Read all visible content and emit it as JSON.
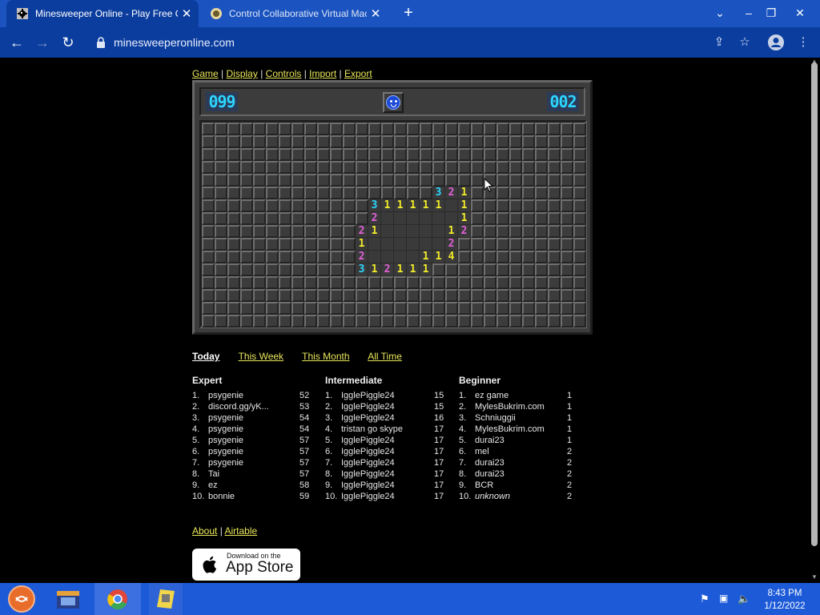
{
  "browser": {
    "tabs": [
      {
        "title": "Minesweeper Online - Play Free Online",
        "active": true
      },
      {
        "title": "Control Collaborative Virtual Machine",
        "active": false
      }
    ],
    "url": "minesweeperonline.com"
  },
  "menu": {
    "items": [
      "Game",
      "Display",
      "Controls",
      "Import",
      "Export"
    ],
    "separator": "|"
  },
  "game": {
    "mines_counter": "099",
    "timer": "002",
    "face": "smiley",
    "rows": 16,
    "cols": 30,
    "open_cells": [
      {
        "r": 5,
        "c": 18,
        "v": "3"
      },
      {
        "r": 5,
        "c": 19,
        "v": "2"
      },
      {
        "r": 5,
        "c": 20,
        "v": "1"
      },
      {
        "r": 6,
        "c": 13,
        "v": "3"
      },
      {
        "r": 6,
        "c": 14,
        "v": "1"
      },
      {
        "r": 6,
        "c": 15,
        "v": "1"
      },
      {
        "r": 6,
        "c": 16,
        "v": "1"
      },
      {
        "r": 6,
        "c": 17,
        "v": "1"
      },
      {
        "r": 6,
        "c": 18,
        "v": "1"
      },
      {
        "r": 6,
        "c": 19,
        "v": ""
      },
      {
        "r": 6,
        "c": 20,
        "v": "1"
      },
      {
        "r": 7,
        "c": 13,
        "v": "2"
      },
      {
        "r": 7,
        "c": 14,
        "v": ""
      },
      {
        "r": 7,
        "c": 15,
        "v": ""
      },
      {
        "r": 7,
        "c": 16,
        "v": ""
      },
      {
        "r": 7,
        "c": 17,
        "v": ""
      },
      {
        "r": 7,
        "c": 18,
        "v": ""
      },
      {
        "r": 7,
        "c": 19,
        "v": ""
      },
      {
        "r": 7,
        "c": 20,
        "v": "1"
      },
      {
        "r": 8,
        "c": 12,
        "v": "2"
      },
      {
        "r": 8,
        "c": 13,
        "v": "1"
      },
      {
        "r": 8,
        "c": 14,
        "v": ""
      },
      {
        "r": 8,
        "c": 15,
        "v": ""
      },
      {
        "r": 8,
        "c": 16,
        "v": ""
      },
      {
        "r": 8,
        "c": 17,
        "v": ""
      },
      {
        "r": 8,
        "c": 18,
        "v": ""
      },
      {
        "r": 8,
        "c": 19,
        "v": "1"
      },
      {
        "r": 8,
        "c": 20,
        "v": "2"
      },
      {
        "r": 9,
        "c": 12,
        "v": "1"
      },
      {
        "r": 9,
        "c": 13,
        "v": ""
      },
      {
        "r": 9,
        "c": 14,
        "v": ""
      },
      {
        "r": 9,
        "c": 15,
        "v": ""
      },
      {
        "r": 9,
        "c": 16,
        "v": ""
      },
      {
        "r": 9,
        "c": 17,
        "v": ""
      },
      {
        "r": 9,
        "c": 18,
        "v": ""
      },
      {
        "r": 9,
        "c": 19,
        "v": "2"
      },
      {
        "r": 10,
        "c": 12,
        "v": "2"
      },
      {
        "r": 10,
        "c": 13,
        "v": ""
      },
      {
        "r": 10,
        "c": 14,
        "v": ""
      },
      {
        "r": 10,
        "c": 15,
        "v": ""
      },
      {
        "r": 10,
        "c": 16,
        "v": ""
      },
      {
        "r": 10,
        "c": 17,
        "v": "1"
      },
      {
        "r": 10,
        "c": 18,
        "v": "1"
      },
      {
        "r": 10,
        "c": 19,
        "v": "4"
      },
      {
        "r": 11,
        "c": 12,
        "v": "3"
      },
      {
        "r": 11,
        "c": 13,
        "v": "1"
      },
      {
        "r": 11,
        "c": 14,
        "v": "2"
      },
      {
        "r": 11,
        "c": 15,
        "v": "1"
      },
      {
        "r": 11,
        "c": 16,
        "v": "1"
      },
      {
        "r": 11,
        "c": 17,
        "v": "1"
      }
    ]
  },
  "leaderboard": {
    "periods": [
      "Today",
      "This Week",
      "This Month",
      "All Time"
    ],
    "current_period": "Today",
    "expert": {
      "title": "Expert",
      "rows": [
        {
          "rank": "1.",
          "name": "psygenie",
          "score": "52"
        },
        {
          "rank": "2.",
          "name": "discord.gg/yK...",
          "score": "53"
        },
        {
          "rank": "3.",
          "name": "psygenie",
          "score": "54"
        },
        {
          "rank": "4.",
          "name": "psygenie",
          "score": "54"
        },
        {
          "rank": "5.",
          "name": "psygenie",
          "score": "57"
        },
        {
          "rank": "6.",
          "name": "psygenie",
          "score": "57"
        },
        {
          "rank": "7.",
          "name": "psygenie",
          "score": "57"
        },
        {
          "rank": "8.",
          "name": "Tai",
          "score": "57"
        },
        {
          "rank": "9.",
          "name": "ez",
          "score": "58"
        },
        {
          "rank": "10.",
          "name": "bonnie",
          "score": "59"
        }
      ]
    },
    "intermediate": {
      "title": "Intermediate",
      "rows": [
        {
          "rank": "1.",
          "name": "IgglePiggle24",
          "score": "15"
        },
        {
          "rank": "2.",
          "name": "IgglePiggle24",
          "score": "15"
        },
        {
          "rank": "3.",
          "name": "IgglePiggle24",
          "score": "16"
        },
        {
          "rank": "4.",
          "name": "tristan go skype",
          "score": "17"
        },
        {
          "rank": "5.",
          "name": "IgglePiggle24",
          "score": "17"
        },
        {
          "rank": "6.",
          "name": "IgglePiggle24",
          "score": "17"
        },
        {
          "rank": "7.",
          "name": "IgglePiggle24",
          "score": "17"
        },
        {
          "rank": "8.",
          "name": "IgglePiggle24",
          "score": "17"
        },
        {
          "rank": "9.",
          "name": "IgglePiggle24",
          "score": "17"
        },
        {
          "rank": "10.",
          "name": "IgglePiggle24",
          "score": "17"
        }
      ]
    },
    "beginner": {
      "title": "Beginner",
      "rows": [
        {
          "rank": "1.",
          "name": "ez game",
          "score": "1"
        },
        {
          "rank": "2.",
          "name": "MylesBukrim.com",
          "score": "1"
        },
        {
          "rank": "3.",
          "name": "Schniuggii",
          "score": "1"
        },
        {
          "rank": "4.",
          "name": "MylesBukrim.com",
          "score": "1"
        },
        {
          "rank": "5.",
          "name": "durai23",
          "score": "1"
        },
        {
          "rank": "6.",
          "name": "mel",
          "score": "2"
        },
        {
          "rank": "7.",
          "name": "durai23",
          "score": "2"
        },
        {
          "rank": "8.",
          "name": "durai23",
          "score": "2"
        },
        {
          "rank": "9.",
          "name": "BCR",
          "score": "2"
        },
        {
          "rank": "10.",
          "name": "unknown",
          "score": "2",
          "italic": true
        }
      ]
    }
  },
  "footer": {
    "about": "About",
    "airtable": "Airtable",
    "separator": "|",
    "appstore_small": "Download on the",
    "appstore_big": "App Store"
  },
  "taskbar": {
    "time": "8:43 PM",
    "date": "1/12/2022"
  },
  "colors": {
    "link": "#e8e65a",
    "chrome_tabstrip": "#1b54c0",
    "chrome_toolbar": "#0b3d9e",
    "taskbar": "#1c5ad8",
    "num1": "#f2ec2a",
    "num2": "#e060d8",
    "num3": "#2bd6ff"
  },
  "icons": [
    "minesweeper-favicon",
    "vm-favicon",
    "back-icon",
    "forward-icon",
    "reload-icon",
    "lock-icon",
    "share-icon",
    "star-icon",
    "profile-icon",
    "menu-icon",
    "apple-icon",
    "start-icon"
  ]
}
